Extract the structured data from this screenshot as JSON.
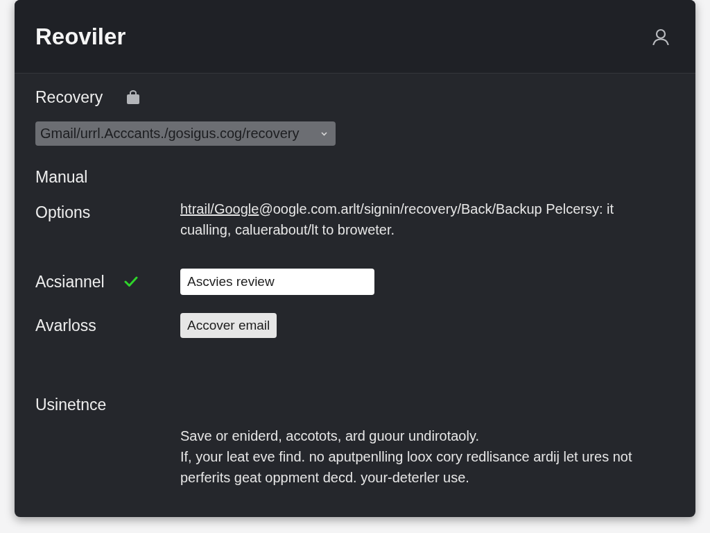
{
  "header": {
    "title": "Reoviler"
  },
  "recovery": {
    "label": "Recovery",
    "url_select": {
      "value": "Gmail/urrl.Acccants./gosigus.cog/recovery"
    }
  },
  "manual": {
    "label": "Manual"
  },
  "options": {
    "label": "Options",
    "link": "htrail/Google",
    "text": "@oogle.com.arlt/signin/recovery/Back/Backup Pelcersy: it cualling, caluerabout/lt to broweter."
  },
  "fields": [
    {
      "kind": "input",
      "label": "Acsiannel",
      "verified": true,
      "value": "Ascvies review"
    },
    {
      "kind": "button",
      "label": "Avarloss",
      "verified": false,
      "text": "Accover email"
    }
  ],
  "usage": {
    "label": "Usinetnce",
    "paragraphs": [
      "Save or eniderd, accotots, ard guour undirotaoly.",
      "If, your leat eve find. no aputpenlling loox cory redlisance ardij let ures not perferits geat oppment decd. your-deterler use."
    ]
  }
}
